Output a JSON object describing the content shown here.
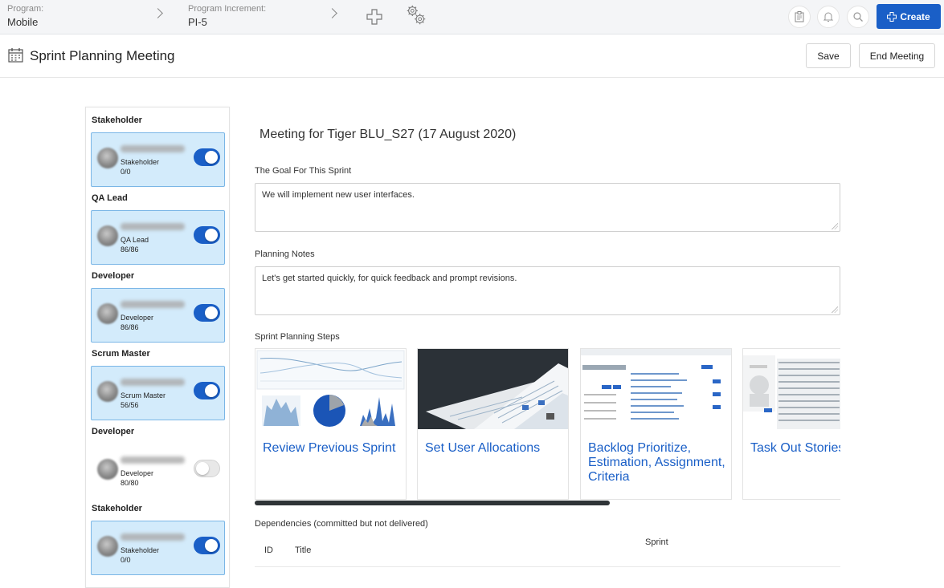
{
  "topbar": {
    "program_label": "Program:",
    "program_value": "Mobile",
    "increment_label": "Program Increment:",
    "increment_value": "PI-5",
    "create_label": "Create",
    "icons": [
      "chevron-right-icon",
      "plus-icon",
      "gears-icon",
      "clipboard-icon",
      "bell-icon",
      "search-icon"
    ]
  },
  "header": {
    "title": "Sprint Planning Meeting",
    "save_label": "Save",
    "end_label": "End Meeting"
  },
  "sidebar": {
    "members": [
      {
        "group": "Stakeholder",
        "role": "Stakeholder",
        "count": "0/0",
        "active": true
      },
      {
        "group": "QA Lead",
        "role": "QA Lead",
        "count": "86/86",
        "active": true
      },
      {
        "group": "Developer",
        "role": "Developer",
        "count": "86/86",
        "active": true
      },
      {
        "group": "Scrum Master",
        "role": "Scrum Master",
        "count": "56/56",
        "active": true
      },
      {
        "group": "Developer",
        "role": "Developer",
        "count": "80/80",
        "active": false
      },
      {
        "group": "Stakeholder",
        "role": "Stakeholder",
        "count": "0/0",
        "active": true
      }
    ]
  },
  "main": {
    "meeting_title": "Meeting for Tiger BLU_S27 (17 August 2020)",
    "goal_label": "The Goal For This Sprint",
    "goal_value": "We will implement new user interfaces.",
    "notes_label": "Planning Notes",
    "notes_value": "Let's get started quickly, for quick feedback and prompt revisions.",
    "steps_label": "Sprint Planning Steps",
    "steps": [
      {
        "title": "Review Previous Sprint"
      },
      {
        "title": "Set User Allocations"
      },
      {
        "title": "Backlog Prioritize, Estimation, Assignment, Criteria"
      },
      {
        "title": "Task Out Stories"
      }
    ],
    "dependencies_label": "Dependencies (committed but not delivered)",
    "table_headers": {
      "id": "ID",
      "title": "Title",
      "sprint": "Sprint"
    }
  },
  "colors": {
    "accent": "#1a5fc7",
    "card_active_bg": "#d3ebfb"
  }
}
